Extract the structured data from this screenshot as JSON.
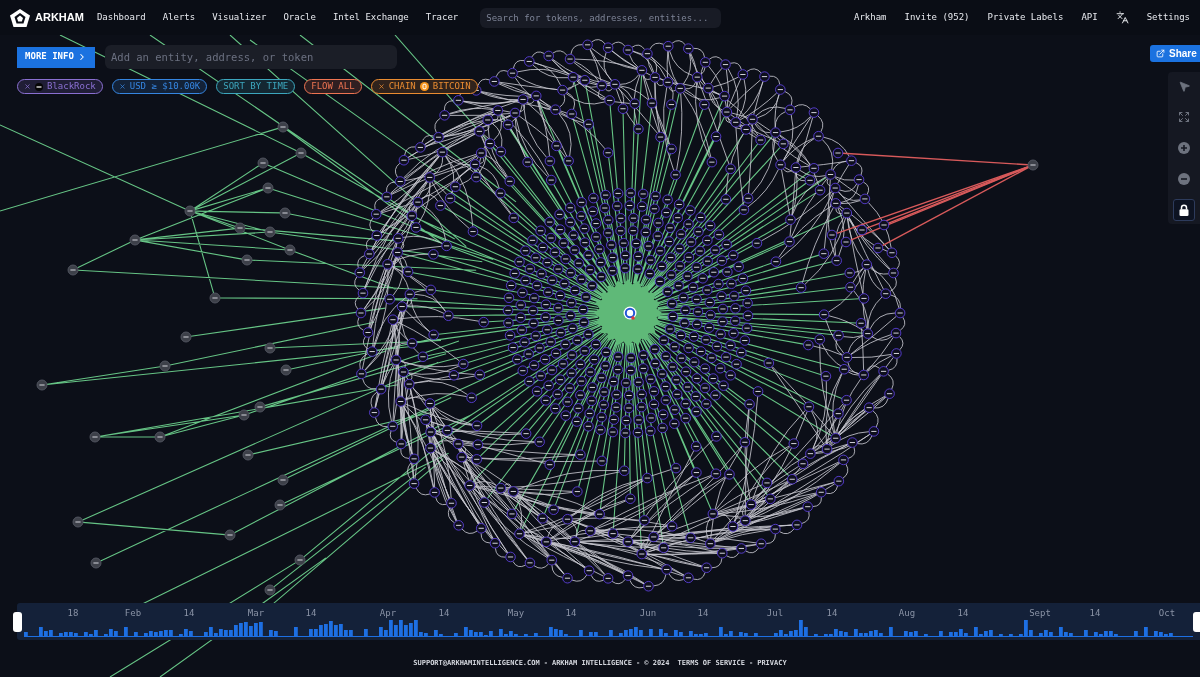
{
  "header": {
    "brand": "ARKHAM",
    "nav": [
      "Dashboard",
      "Alerts",
      "Visualizer",
      "Oracle",
      "Intel Exchange",
      "Tracer"
    ],
    "search": {
      "placeholder": "Search for tokens, addresses, entities..."
    },
    "right_items": [
      {
        "kind": "link",
        "label": "Arkham"
      },
      {
        "kind": "link",
        "label": "Invite (952)"
      },
      {
        "kind": "link",
        "label": "Private Labels"
      },
      {
        "kind": "link",
        "label": "API"
      },
      {
        "kind": "language"
      },
      {
        "kind": "link",
        "label": "Settings"
      }
    ]
  },
  "controls": {
    "more_info": "MORE INFO",
    "entity_field": {
      "placeholder": "Add an entity, address, or token"
    },
    "share": "Share"
  },
  "filters": [
    {
      "kind": "entity",
      "removable": true,
      "label": "BlackRock",
      "color": "#8a6fd1"
    },
    {
      "kind": "plain",
      "removable": true,
      "label": "USD ≥ $10.00K",
      "color": "#3585e0"
    },
    {
      "kind": "plain",
      "removable": false,
      "label": "SORT BY TIME",
      "color": "#3ca6bd"
    },
    {
      "kind": "plain",
      "removable": false,
      "label": "FLOW ALL",
      "color": "#ee7452"
    },
    {
      "kind": "chain",
      "removable": true,
      "prefix": "CHAIN",
      "label": "BITCOIN",
      "color": "#ea8c31"
    }
  ],
  "canvas_tools": [
    {
      "kind": "pointer",
      "selected": false
    },
    {
      "kind": "fit",
      "selected": false
    },
    {
      "kind": "zoom_in",
      "selected": false
    },
    {
      "kind": "zoom_out",
      "selected": false
    },
    {
      "kind": "lock",
      "selected": true
    }
  ],
  "timeline": {
    "ticks": [
      "18",
      "Feb",
      "14",
      "Mar",
      "14",
      "Apr",
      "14",
      "May",
      "14",
      "Jun",
      "14",
      "Jul",
      "14",
      "Aug",
      "14",
      "Sept",
      "14",
      "Oct"
    ]
  },
  "footer": {
    "email": "SUPPORT@ARKHAMINTELLIGENCE.COM",
    "company": "ARKHAM INTELLIGENCE",
    "copyright": "© 2024",
    "separator": "-",
    "links": [
      "TERMS OF SERVICE",
      "PRIVACY"
    ]
  }
}
